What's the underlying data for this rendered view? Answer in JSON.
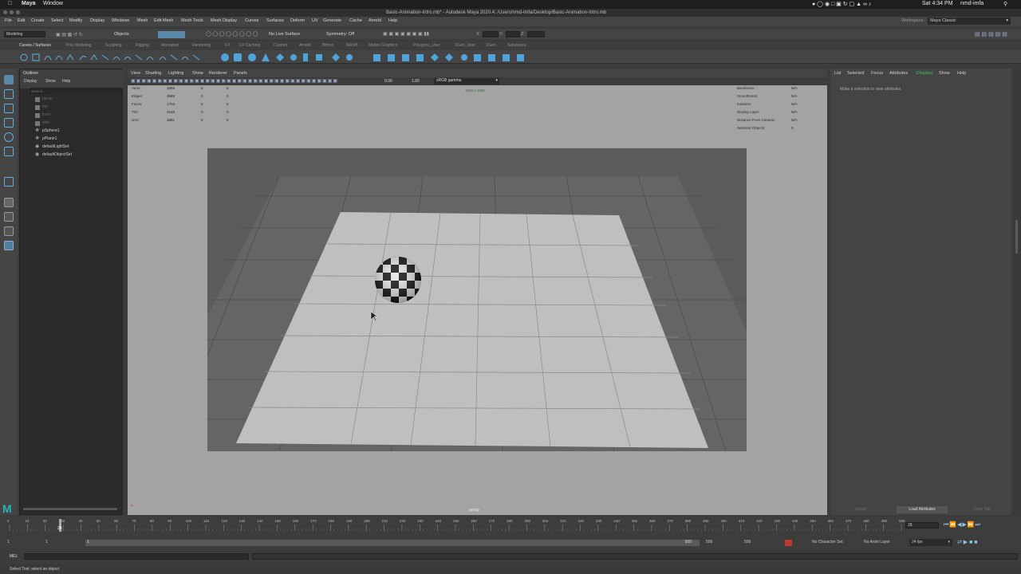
{
  "mac": {
    "app": "Maya",
    "menu_window": "Window",
    "clock": "Sat 4:34 PM",
    "user": "nmd-imfa"
  },
  "window": {
    "title": "Basic-Animation-Intro.mb* - Autodesk Maya 2020.4: /Users/nmd-imfa/Desktop/Basic-Animation-Intro.mb"
  },
  "menu": [
    "File",
    "Edit",
    "Create",
    "Select",
    "Modify",
    "Display",
    "Windows",
    "Mesh",
    "Edit Mesh",
    "Mesh Tools",
    "Mesh Display",
    "Curves",
    "Surfaces",
    "Deform",
    "UV",
    "Generate",
    "Cache",
    "Arnold",
    "Help"
  ],
  "workspace": {
    "label": "Workspace :",
    "value": "Maya Classic"
  },
  "status": {
    "menuset": "Modeling",
    "objects": "Objects",
    "live_surface": "No Live Surface",
    "symmetry": "Symmetry: Off",
    "x": "X:",
    "y": "Y:",
    "z": "Z:"
  },
  "shelf_tabs": [
    "Curves / Surfaces",
    "Poly Modeling",
    "Sculpting",
    "Rigging",
    "Animation",
    "Rendering",
    "FX",
    "FX Caching",
    "Custom",
    "Arnold",
    "Bifrost",
    "MASH",
    "Motion Graphics",
    "Polygons_User",
    "XGen_User",
    "XGen",
    "Substance"
  ],
  "outliner": {
    "title": "Outliner",
    "menus": [
      "Display",
      "Show",
      "Help"
    ],
    "search_placeholder": "Search...",
    "items": [
      {
        "label": "persp",
        "dim": true
      },
      {
        "label": "top",
        "dim": true
      },
      {
        "label": "front",
        "dim": true
      },
      {
        "label": "side",
        "dim": true
      },
      {
        "label": "pSphere1",
        "dim": false
      },
      {
        "label": "pPlane1",
        "dim": false
      },
      {
        "label": "defaultLightSet",
        "dim": false
      },
      {
        "label": "defaultObjectSet",
        "dim": false
      }
    ]
  },
  "viewport": {
    "menus": [
      "View",
      "Shading",
      "Lighting",
      "Show",
      "Renderer",
      "Panels"
    ],
    "exposure": "0.00",
    "gamma": "1.00",
    "colorspace": "sRGB gamma",
    "resolution": "1920 x 1080",
    "camera": "persp",
    "hud_left": [
      {
        "label": "Verts:",
        "v1": "1855",
        "v2": "0",
        "v3": "0"
      },
      {
        "label": "Edges:",
        "v1": "3568",
        "v2": "0",
        "v3": "0"
      },
      {
        "label": "Faces:",
        "v1": "1704",
        "v2": "0",
        "v3": "0"
      },
      {
        "label": "Tris:",
        "v1": "3248",
        "v2": "0",
        "v3": "0"
      },
      {
        "label": "UVs:",
        "v1": "1881",
        "v2": "0",
        "v3": "0"
      }
    ],
    "hud_right": [
      {
        "label": "Backfaces:",
        "value": "N/A"
      },
      {
        "label": "Smoothness:",
        "value": "N/A"
      },
      {
        "label": "Instance:",
        "value": "N/A"
      },
      {
        "label": "Display Layer:",
        "value": "N/A"
      },
      {
        "label": "Distance From Camera:",
        "value": "N/A"
      },
      {
        "label": "Selected Objects:",
        "value": "0"
      }
    ]
  },
  "attribute_editor": {
    "tabs": [
      "List",
      "Selected",
      "Focus",
      "Attributes",
      "Display",
      "Show",
      "Help"
    ],
    "message": "Make a selection to view attributes",
    "buttons": [
      "Select",
      "Load Attributes",
      "Copy Tab"
    ]
  },
  "timeline": {
    "ticks": [
      "0",
      "10",
      "20",
      "30",
      "40",
      "50",
      "60",
      "70",
      "80",
      "90",
      "100",
      "110",
      "120",
      "130",
      "140",
      "150",
      "160",
      "170",
      "180",
      "190",
      "200",
      "210",
      "220",
      "230",
      "240",
      "250",
      "260",
      "270",
      "280",
      "290",
      "300",
      "310",
      "320",
      "330",
      "340",
      "350",
      "360",
      "370",
      "380",
      "390",
      "400",
      "410",
      "420",
      "430",
      "440",
      "450",
      "460",
      "470",
      "480",
      "490",
      "500"
    ],
    "current_frame": "28",
    "playhead_marker": "28"
  },
  "range": {
    "start": "1",
    "start_inner": "1",
    "slider_start": "1",
    "slider_end": "500",
    "end_inner": "500",
    "end": "500",
    "character_set": "No Character Set",
    "anim_layer": "No Anim Layer",
    "fps": "24 fps"
  },
  "command": {
    "label": "MEL"
  },
  "help": {
    "text": "Select Tool: select an object"
  }
}
